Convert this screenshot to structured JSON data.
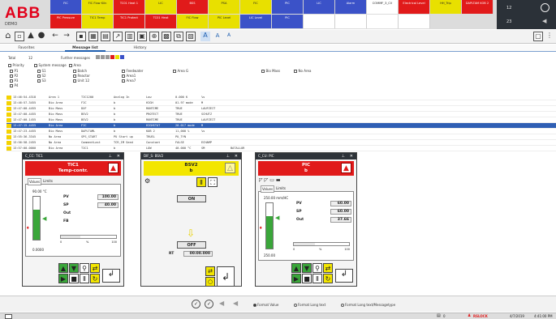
{
  "logo": {
    "text": "ABB",
    "sub": "DEMO"
  },
  "alarm_row_top": [
    {
      "text": "FIC",
      "bg": "#3b52c8",
      "fg": "#ffffff"
    },
    {
      "text": "FIC Flow  Kiln",
      "bg": "#e8e000",
      "fg": "#222222"
    },
    {
      "text": "TC01  Heat 1",
      "bg": "#e11a1a",
      "fg": "#ffffff"
    },
    {
      "text": "LIC",
      "bg": "#e8e000",
      "fg": "#222222"
    },
    {
      "text": "BSS",
      "bg": "#e11a1a",
      "fg": "#ffffff"
    },
    {
      "text": "PSA",
      "bg": "#e8e000",
      "fg": "#222222"
    },
    {
      "text": "FIC",
      "bg": "#e8e000",
      "fg": "#222222"
    },
    {
      "text": "PIC",
      "bg": "#3b52c8",
      "fg": "#ffffff"
    },
    {
      "text": "LIC",
      "bg": "#3b52c8",
      "fg": "#ffffff"
    },
    {
      "text": "Alarm",
      "bg": "#3b52c8",
      "fg": "#ffffff"
    },
    {
      "text": "COMMF_3_CV",
      "bg": "#ffffff",
      "fg": "#222222"
    },
    {
      "text": "Electrical Level",
      "bg": "#e11a1a",
      "fg": "#ffffff"
    },
    {
      "text": "HH_Trip",
      "bg": "#e8e000",
      "fg": "#222222"
    },
    {
      "text": "DAPLTAM  KOB 2",
      "bg": "#e11a1a",
      "fg": "#ffffff"
    }
  ],
  "alarm_row_bottom": [
    {
      "text": "PIC  Pressure",
      "bg": "#e11a1a",
      "fg": "#ffffff"
    },
    {
      "text": "TIC1  Temp",
      "bg": "#e8e000",
      "fg": "#222222"
    },
    {
      "text": "TIC1  Protect",
      "bg": "#e11a1a",
      "fg": "#ffffff"
    },
    {
      "text": "TC01  Heat",
      "bg": "#e11a1a",
      "fg": "#ffffff"
    },
    {
      "text": "FIC  Flow",
      "bg": "#e8e000",
      "fg": "#222222"
    },
    {
      "text": "PIC  Level",
      "bg": "#e8e000",
      "fg": "#222222"
    },
    {
      "text": "LIC  Level",
      "bg": "#3b52c8",
      "fg": "#ffffff"
    },
    {
      "text": "PIC",
      "bg": "#3b52c8",
      "fg": "#ffffff"
    },
    {
      "text": "",
      "bg": "#ffffff",
      "fg": "#222222"
    },
    {
      "text": "",
      "bg": "#ffffff",
      "fg": "#222222"
    },
    {
      "text": "",
      "bg": "#ffffff",
      "fg": "#222222"
    },
    {
      "text": "",
      "bg": "#ffffff",
      "fg": "#222222"
    }
  ],
  "alarm_counts": {
    "top": "12",
    "bottom": "23"
  },
  "tabs": [
    "Favorites",
    "Message list",
    "History"
  ],
  "filter": {
    "total_label": "Total",
    "total_value": "12",
    "further_label": "Further messages",
    "priority": "Priority",
    "system_message": "System message",
    "area": "Area",
    "col1": [
      "P1",
      "P2",
      "P3",
      "P4"
    ],
    "col2": [
      "S1",
      "S2",
      "S3"
    ],
    "col3": [
      "Batch",
      "Reactor",
      "Unit 12"
    ],
    "col4": [
      "Feedwater",
      "Area1",
      "Area7"
    ],
    "col5": [
      "Area G"
    ],
    "col6": [
      "Bio Mass"
    ],
    "col7": [
      "No Area"
    ]
  },
  "events": [
    {
      "time": "13:46:54.4318",
      "area": "Area 1",
      "tag": "TIC1200",
      "desc": "Analog In",
      "cond": "Low",
      "val": "0.000 K",
      "unit": "%s",
      "note": ""
    },
    {
      "time": "13:46:57.3455",
      "area": "Bio Area",
      "tag": "FIC",
      "desc": "b",
      "cond": "HIGH",
      "val": "01.97 mode",
      "unit": "M",
      "note": ""
    },
    {
      "time": "13:47:00.4455",
      "area": "Bio Mass",
      "tag": "DXF",
      "desc": "b",
      "cond": "RUNTIME",
      "val": "TRUE",
      "unit": "LAUFZEIT",
      "note": ""
    },
    {
      "time": "13:47:00.4455",
      "area": "Bio Mass",
      "tag": "BSV2",
      "desc": "b",
      "cond": "PROTECT",
      "val": "TRUE",
      "unit": "SCHUTZ",
      "note": ""
    },
    {
      "time": "13:47:00.1455",
      "area": "Bio Mass",
      "tag": "BSV2",
      "desc": "b",
      "cond": "RUNTIME",
      "val": "TRUE",
      "unit": "LAUFZEIT",
      "note": ""
    },
    {
      "time": "13:47:15.4455",
      "area": "Bio Area",
      "tag": "FIC",
      "desc": "b",
      "cond": "HIGHSTAT",
      "val": "20.017 mode",
      "unit": "M",
      "note": ""
    },
    {
      "time": "13:47:23.4455",
      "area": "Bio Mass",
      "tag": "DAPLTAML",
      "desc": "b",
      "cond": "KOB 2",
      "val": "11,000 %",
      "unit": "%s",
      "note": ""
    },
    {
      "time": "13:55:36.3345",
      "area": "No Area",
      "tag": "SPS_START",
      "desc": "PU Start up",
      "cond": "TRUEL",
      "val": "PU_TYN",
      "unit": "",
      "note": ""
    },
    {
      "time": "13:56:58.2455",
      "area": "No Area",
      "tag": "CommentLast",
      "desc": "TCR_IM Seed",
      "cond": "Constant",
      "val": "FALSE",
      "unit": "ECHAMP",
      "note": ""
    },
    {
      "time": "13:57:00.0000",
      "area": "Bio Area",
      "tag": "TIC1",
      "desc": "b",
      "cond": "LOW",
      "val": "40.000 °C",
      "unit": "SM",
      "note": "BATALLOR"
    }
  ],
  "fp1": {
    "title": "C_CC: TIC1",
    "tag": "TIC1",
    "desc": "Temp-contr.",
    "tabs": [
      "Values",
      "Limits"
    ],
    "scale_top": "90.00 °C",
    "scale_bottom": "0.0000",
    "rows": [
      {
        "label": "PV",
        "value": "100.00"
      },
      {
        "label": "SP",
        "value": "40.00"
      },
      {
        "label": "Out",
        "value": ""
      },
      {
        "label": "FB",
        "value": ""
      }
    ],
    "slider_labels": [
      "0",
      "%",
      "100"
    ]
  },
  "fp2": {
    "title": "DIF_S: BSV2",
    "tag": "BSV2",
    "desc": "b",
    "on_label": "ON",
    "off_label": "OFF",
    "rt_label": "RT",
    "rt_value": "00:00.000"
  },
  "fp3": {
    "title": "C_CU: PIC",
    "tag": "PIC",
    "desc": "b",
    "tabs": [
      "Values",
      "Limits"
    ],
    "scale_top": "250.00 mm/HC",
    "scale_bottom": "250.00",
    "rows": [
      {
        "label": "PV",
        "value": "60.00"
      },
      {
        "label": "SP",
        "value": "60.00"
      },
      {
        "label": "Out",
        "value": "37.66"
      }
    ],
    "slider_labels": [
      "0",
      "%",
      "100"
    ]
  },
  "bottom": {
    "radio1": "Format Value",
    "radio2": "Format Long text",
    "radio3": "Format Long text/Messagetype"
  },
  "status": {
    "user": "RSLOCK",
    "date": "4/7/2019",
    "time": "4:41:00 PM",
    "count": "0"
  }
}
